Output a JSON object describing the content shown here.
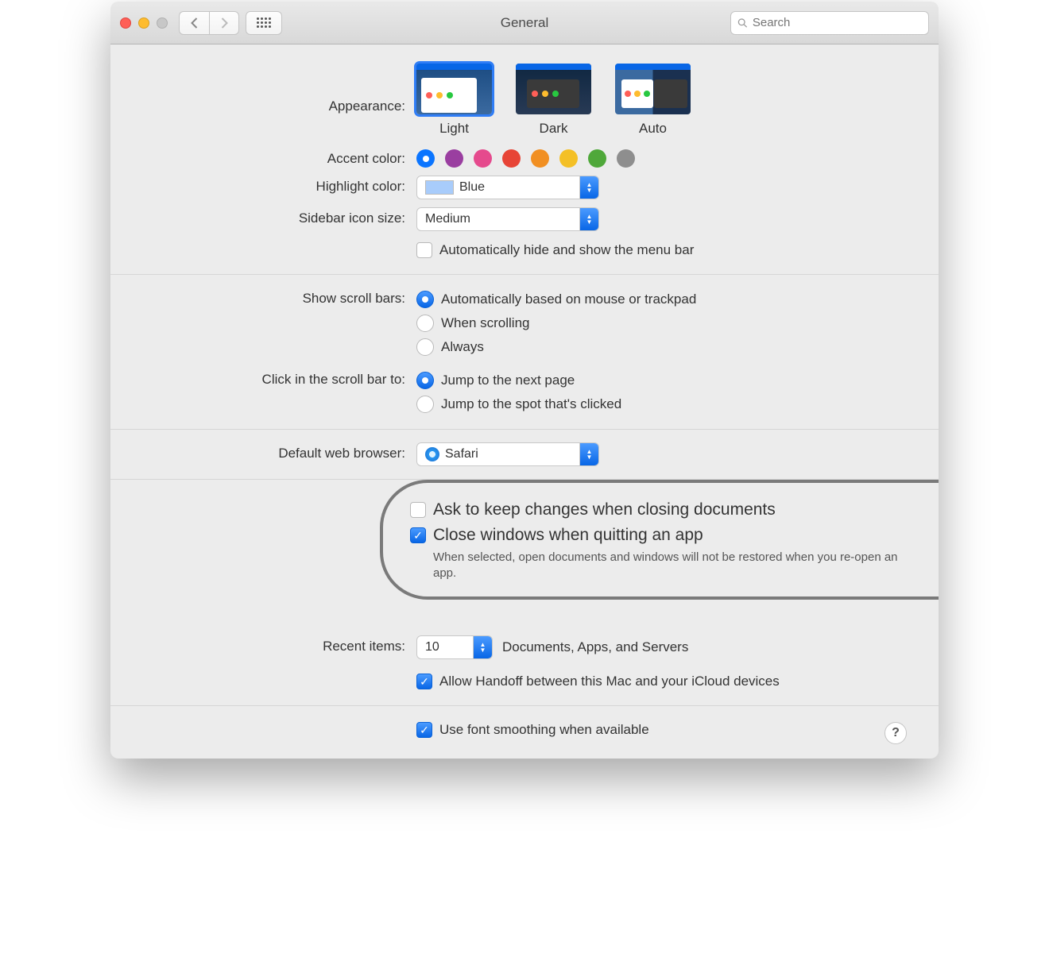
{
  "window": {
    "title": "General",
    "search_placeholder": "Search"
  },
  "appearance": {
    "label": "Appearance:",
    "options": [
      "Light",
      "Dark",
      "Auto"
    ]
  },
  "accent": {
    "label": "Accent color:",
    "colors": [
      "#0b75ff",
      "#9a3ea0",
      "#e54a8d",
      "#e74436",
      "#f18f22",
      "#f4c026",
      "#4fa83a",
      "#8e8e8e"
    ]
  },
  "highlight": {
    "label": "Highlight color:",
    "value": "Blue"
  },
  "sidebar_size": {
    "label": "Sidebar icon size:",
    "value": "Medium"
  },
  "menubar_auto": "Automatically hide and show the menu bar",
  "scrollbars": {
    "label": "Show scroll bars:",
    "opts": [
      "Automatically based on mouse or trackpad",
      "When scrolling",
      "Always"
    ]
  },
  "click_scroll": {
    "label": "Click in the scroll bar to:",
    "opts": [
      "Jump to the next page",
      "Jump to the spot that's clicked"
    ]
  },
  "browser": {
    "label": "Default web browser:",
    "value": "Safari"
  },
  "docs": {
    "ask": "Ask to keep changes when closing documents",
    "close": "Close windows when quitting an app",
    "desc": "When selected, open documents and windows will not be restored when you re-open an app."
  },
  "recent": {
    "label": "Recent items:",
    "value": "10",
    "suffix": "Documents, Apps, and Servers"
  },
  "handoff": "Allow Handoff between this Mac and your iCloud devices",
  "fontsmooth": "Use font smoothing when available",
  "help": "?"
}
